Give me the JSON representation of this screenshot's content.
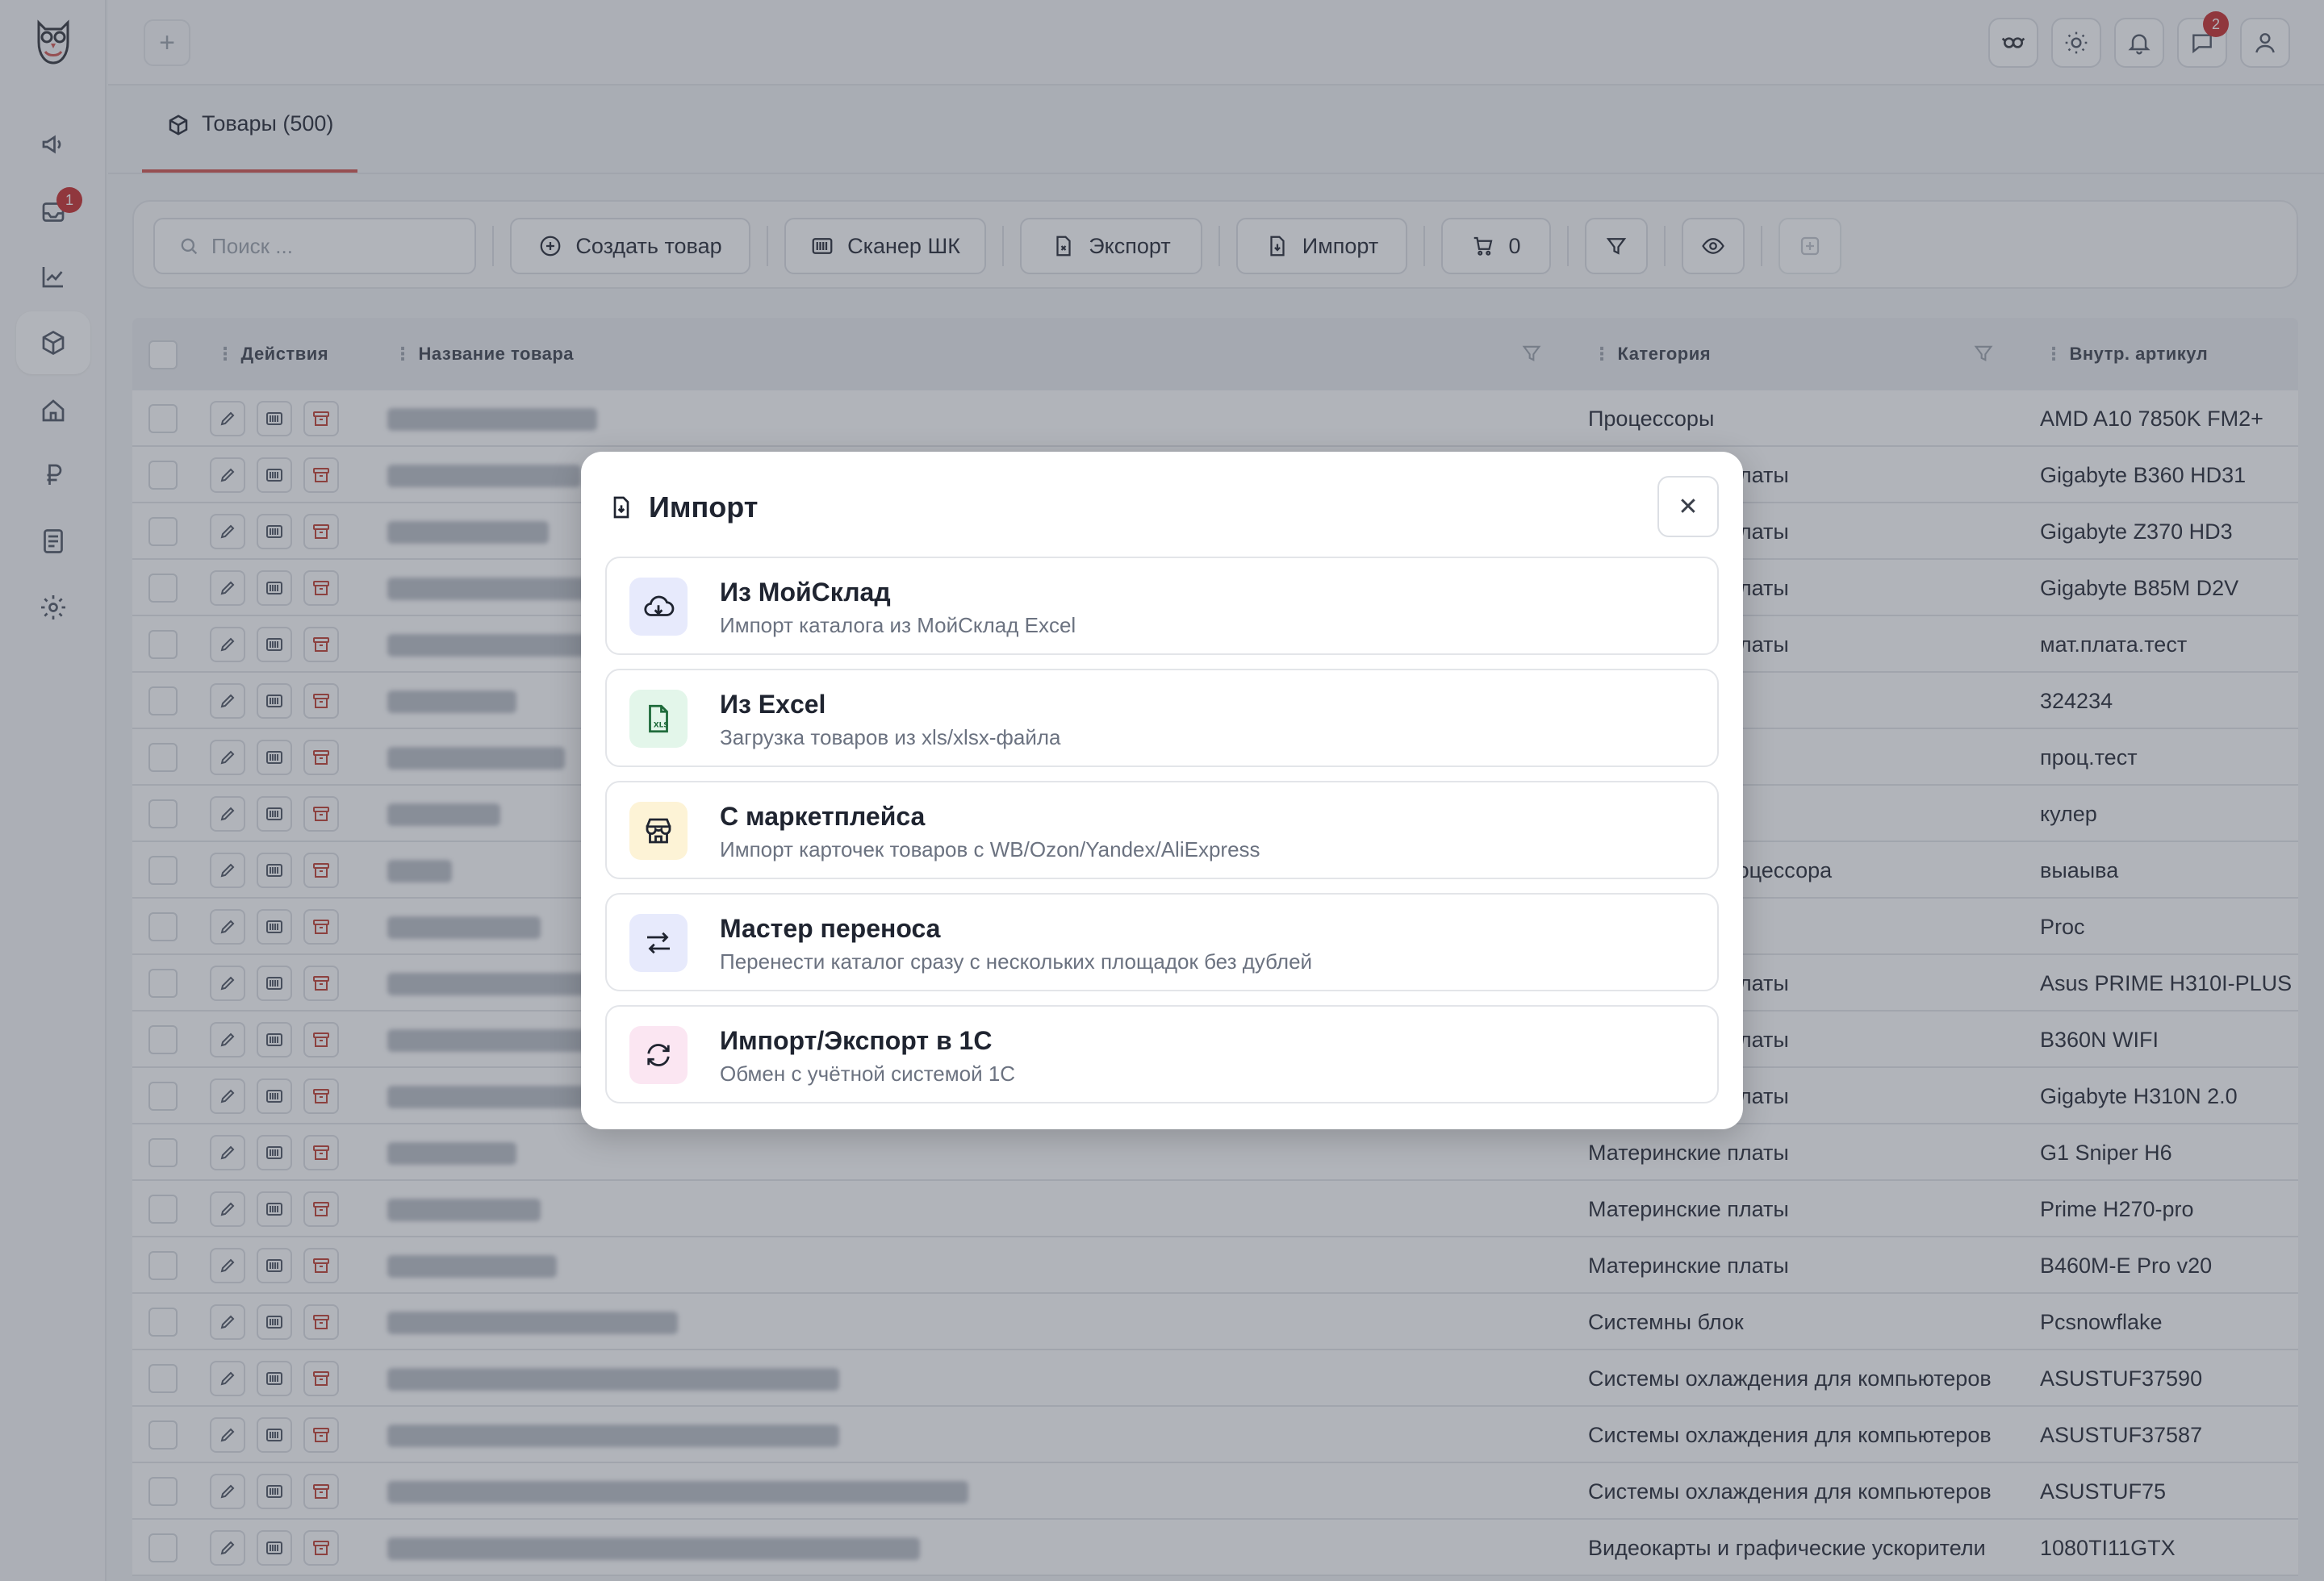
{
  "tab": {
    "label": "Товары (500)"
  },
  "toolbar": {
    "search_placeholder": "Поиск ...",
    "create_label": "Создать товар",
    "scanner_label": "Сканер ШК",
    "export_label": "Экспорт",
    "import_label": "Импорт",
    "cart_count": "0"
  },
  "sidebar": {
    "badge": "1"
  },
  "topbar": {
    "messages_badge": "2"
  },
  "table": {
    "columns": {
      "actions": "Действия",
      "name": "Название товара",
      "category": "Категория",
      "article": "Внутр. артикул"
    },
    "rows": [
      {
        "category": "Процессоры",
        "article": "AMD A10 7850K FM2+"
      },
      {
        "category": "Материнские платы",
        "article": "Gigabyte B360 HD31"
      },
      {
        "category": "Материнские платы",
        "article": "Gigabyte Z370 HD3"
      },
      {
        "category": "Материнские платы",
        "article": "Gigabyte B85M D2V"
      },
      {
        "category": "Материнские платы",
        "article": "мат.плата.тест"
      },
      {
        "category": "",
        "article": "324234"
      },
      {
        "category": "",
        "article": "проц.тест"
      },
      {
        "category": "",
        "article": "кулер"
      },
      {
        "category": "Кулеры для процессора",
        "article": "выаыва"
      },
      {
        "category": "",
        "article": "Proc"
      },
      {
        "category": "Материнские платы",
        "article": "Asus PRIME H310I-PLUS"
      },
      {
        "category": "Материнские платы",
        "article": "B360N WIFI"
      },
      {
        "category": "Материнские платы",
        "article": "Gigabyte H310N 2.0"
      },
      {
        "category": "Материнские платы",
        "article": "G1 Sniper H6"
      },
      {
        "category": "Материнские платы",
        "article": "Prime H270-pro"
      },
      {
        "category": "Материнские платы",
        "article": "B460M-E Pro v20"
      },
      {
        "category": "Системны блок",
        "article": "Pcsnowflake"
      },
      {
        "category": "Системы охлаждения для компьютеров",
        "article": "ASUSTUF37590"
      },
      {
        "category": "Системы охлаждения для компьютеров",
        "article": "ASUSTUF37587"
      },
      {
        "category": "Системы охлаждения для компьютеров",
        "article": "ASUSTUF75"
      },
      {
        "category": "Видеокарты и графические ускорители",
        "article": "1080TI11GTX"
      }
    ]
  },
  "modal": {
    "title": "Импорт",
    "options": [
      {
        "title": "Из МойСклад",
        "subtitle": "Импорт каталога из МойСклад Excel",
        "icon": "cloud-download-icon",
        "color": "#e7eafc"
      },
      {
        "title": "Из Excel",
        "subtitle": "Загрузка товаров из xls/xlsx-файла",
        "icon": "xls-file-icon",
        "color": "#e3f6ea"
      },
      {
        "title": "С маркетплейса",
        "subtitle": "Импорт карточек товаров с WB/Ozon/Yandex/AliExpress",
        "icon": "store-icon",
        "color": "#fdf3d6"
      },
      {
        "title": "Мастер переноса",
        "subtitle": "Перенести каталог сразу с нескольких площадок без дублей",
        "icon": "transfer-arrows-icon",
        "color": "#e7eafc"
      },
      {
        "title": "Импорт/Экспорт в 1С",
        "subtitle": "Обмен с учётной системой 1С",
        "icon": "sync-icon",
        "color": "#fbe6f2"
      }
    ]
  }
}
